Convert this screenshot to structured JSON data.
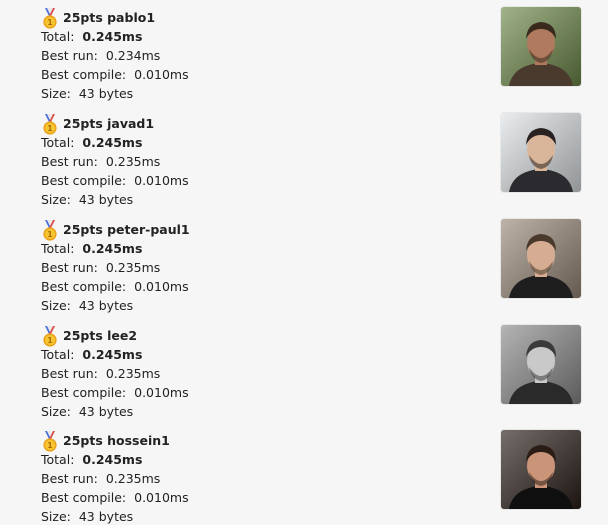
{
  "labels": {
    "total": "Total:",
    "best_run": "Best run:",
    "best_compile": "Best compile:",
    "size": "Size:"
  },
  "entries": [
    {
      "medal": "gold-medal-icon",
      "title": "25pts pablo1",
      "total": "0.245ms",
      "best_run": "0.234ms",
      "best_compile": "0.010ms",
      "size": "43 bytes",
      "avatar_colors": {
        "bg": "#6f8a4a",
        "skin": "#b07a5e",
        "hair": "#3a2a1e",
        "shirt": "#4a3a2e"
      }
    },
    {
      "medal": "gold-medal-icon",
      "title": "25pts javad1",
      "total": "0.245ms",
      "best_run": "0.235ms",
      "best_compile": "0.010ms",
      "size": "43 bytes",
      "avatar_colors": {
        "bg": "#dfe3e6",
        "skin": "#d9b59a",
        "hair": "#2a2220",
        "shirt": "#2b2b2f"
      }
    },
    {
      "medal": "gold-medal-icon",
      "title": "25pts peter-paul1",
      "total": "0.245ms",
      "best_run": "0.235ms",
      "best_compile": "0.010ms",
      "size": "43 bytes",
      "avatar_colors": {
        "bg": "#9a8a7a",
        "skin": "#d6ad93",
        "hair": "#4a3a2c",
        "shirt": "#1e1e1e"
      }
    },
    {
      "medal": "gold-medal-icon",
      "title": "25pts lee2",
      "total": "0.245ms",
      "best_run": "0.235ms",
      "best_compile": "0.010ms",
      "size": "43 bytes",
      "avatar_colors": {
        "bg": "#8c8c8c",
        "skin": "#c9c9c9",
        "hair": "#3a3a3a",
        "shirt": "#2a2a2a"
      }
    },
    {
      "medal": "gold-medal-icon",
      "title": "25pts hossein1",
      "total": "0.245ms",
      "best_run": "0.235ms",
      "best_compile": "0.010ms",
      "size": "43 bytes",
      "avatar_colors": {
        "bg": "#2a1f1a",
        "skin": "#c99478",
        "hair": "#2b1d16",
        "shirt": "#0f0f10"
      }
    }
  ]
}
